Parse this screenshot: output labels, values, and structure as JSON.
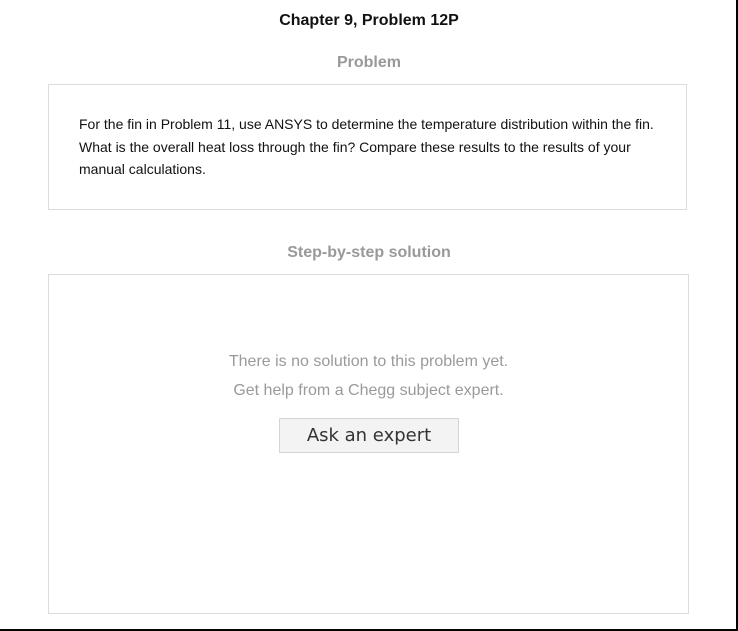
{
  "page": {
    "title": "Chapter 9, Problem 12P"
  },
  "problem": {
    "heading": "Problem",
    "text": "For the fin in Problem 11, use ANSYS to determine the temperature distribution within the fin. What is the overall heat loss through the fin? Compare these results to the results of your manual calculations."
  },
  "solution": {
    "heading": "Step-by-step solution",
    "empty_message": "There is no solution to this problem yet.",
    "help_message": "Get help from a Chegg subject expert.",
    "ask_button_label": "Ask an expert"
  },
  "colors": {
    "heading_gray": "#999999",
    "border_gray": "#dcdcdc",
    "button_bg": "#f3f3f3"
  }
}
